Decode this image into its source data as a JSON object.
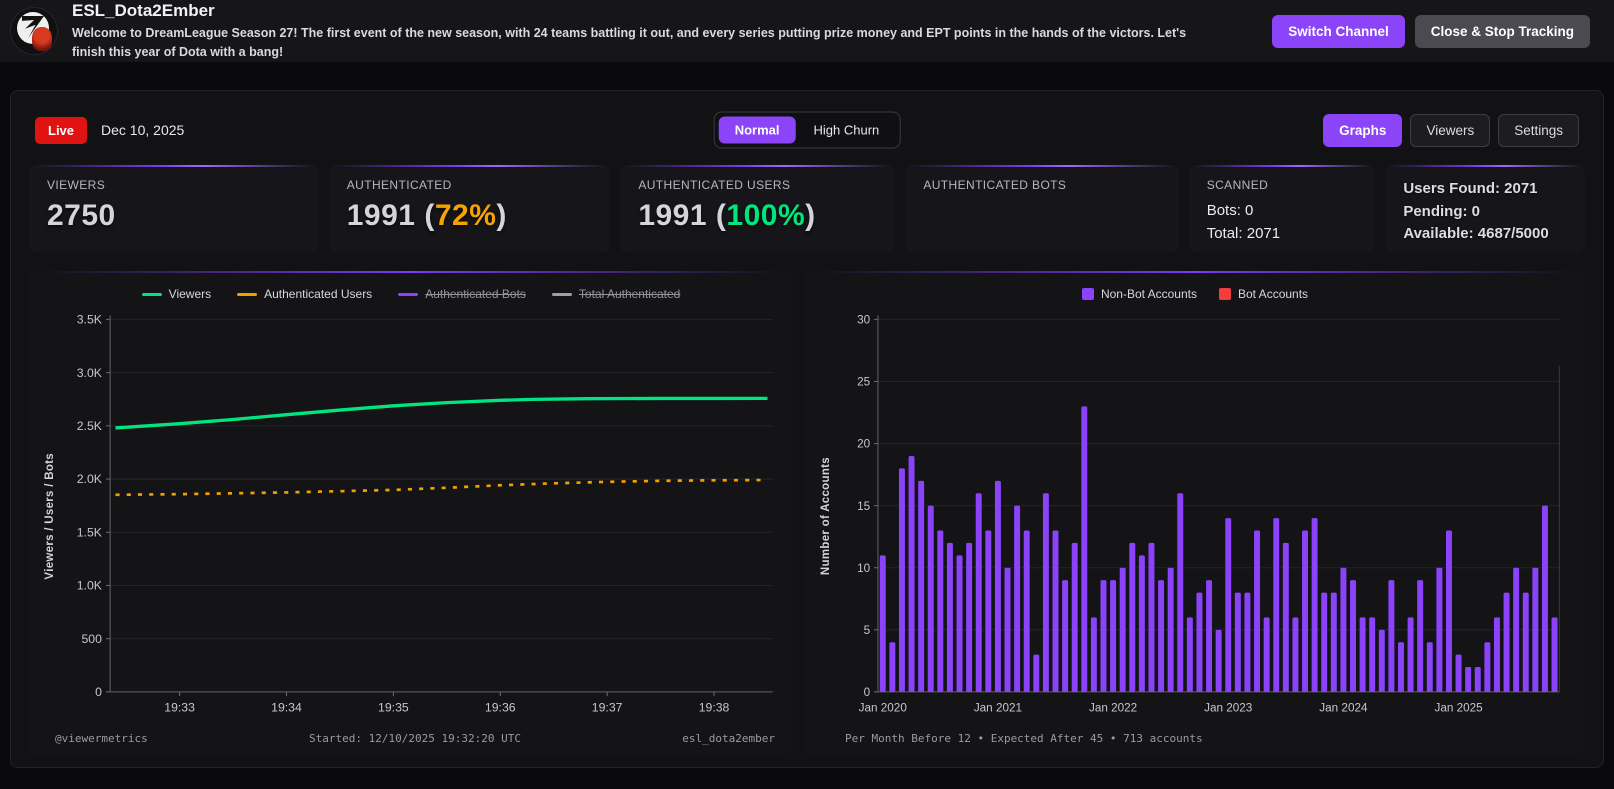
{
  "header": {
    "title": "ESL_Dota2Ember",
    "description": "Welcome to DreamLeague Season 27! The first event of the new season, with 24 teams battling it out, and every series putting prize money and EPT points in the hands of the victors. Let's finish this year of Dota with a bang!",
    "switch_channel_label": "Switch Channel",
    "close_label": "Close & Stop Tracking"
  },
  "toolbar": {
    "live_label": "Live",
    "date": "Dec 10, 2025",
    "mode_toggle": [
      {
        "label": "Normal",
        "active": true
      },
      {
        "label": "High Churn",
        "active": false
      }
    ],
    "view_buttons": [
      {
        "label": "Graphs",
        "active": true
      },
      {
        "label": "Viewers",
        "active": false
      },
      {
        "label": "Settings",
        "active": false
      }
    ]
  },
  "punct": {
    "open": "(",
    "close": ")"
  },
  "stats": {
    "viewers": {
      "label": "VIEWERS",
      "value": "2750"
    },
    "authenticated": {
      "label": "AUTHENTICATED",
      "value": "1991",
      "percent": "72%"
    },
    "authenticated_users": {
      "label": "AUTHENTICATED USERS",
      "value": "1991",
      "percent": "100%"
    },
    "authenticated_bots": {
      "label": "AUTHENTICATED BOTS",
      "value": ""
    },
    "scanned": {
      "label": "SCANNED",
      "bots": "Bots: 0",
      "total": "Total: 2071"
    },
    "quota": {
      "users_found": "Users Found: 2071",
      "pending": "Pending: 0",
      "available": "Available: 4687/5000"
    }
  },
  "colors": {
    "accent_purple": "#8b44f7",
    "live_red": "#e01212",
    "green": "#00e57e",
    "orange": "#f5a300",
    "bar_purple": "#8a43f8",
    "bot_red": "#f23d3d"
  },
  "chart_data": [
    {
      "type": "line",
      "ylabel": "Viewers / Users / Bots",
      "xlim": [
        32.35,
        38.55
      ],
      "ylim": [
        0,
        3500
      ],
      "y_ticks": [
        0,
        500,
        1000,
        1500,
        2000,
        2500,
        3000,
        3500
      ],
      "y_tick_labels": [
        "0",
        "500",
        "1.0K",
        "1.5K",
        "2.0K",
        "2.5K",
        "3.0K",
        "3.5K"
      ],
      "x_ticks": [
        33,
        34,
        35,
        36,
        37,
        38
      ],
      "x_tick_labels": [
        "19:33",
        "19:34",
        "19:35",
        "19:36",
        "19:37",
        "19:38"
      ],
      "grid": true,
      "legend_position": "top-center",
      "series": [
        {
          "name": "Viewers",
          "color": "#00e57e",
          "style": "solid",
          "hidden": false,
          "x": [
            32.4,
            33,
            33.5,
            34,
            34.5,
            35,
            35.5,
            36,
            36.3,
            36.8,
            37.5,
            38,
            38.5
          ],
          "y": [
            2480,
            2520,
            2560,
            2605,
            2648,
            2688,
            2718,
            2740,
            2748,
            2755,
            2757,
            2757,
            2758
          ]
        },
        {
          "name": "Authenticated Users",
          "color": "#f2a000",
          "style": "dashed",
          "hidden": false,
          "x": [
            32.4,
            33,
            34,
            35,
            35.5,
            36,
            36.5,
            37,
            37.5,
            38,
            38.5
          ],
          "y": [
            1852,
            1858,
            1874,
            1898,
            1918,
            1942,
            1960,
            1974,
            1983,
            1988,
            1991
          ]
        },
        {
          "name": "Authenticated Bots",
          "color": "#8a43f8",
          "style": "solid",
          "hidden": true,
          "x": [],
          "y": []
        },
        {
          "name": "Total Authenticated",
          "color": "#9e9ea4",
          "style": "solid",
          "hidden": true,
          "x": [],
          "y": []
        }
      ],
      "footer": {
        "left": "@viewermetrics",
        "center": "Started: 12/10/2025 19:32:20 UTC",
        "right": "esl_dota2ember"
      }
    },
    {
      "type": "bar",
      "ylabel": "Number of Accounts",
      "ylim": [
        0,
        30
      ],
      "y_ticks": [
        0,
        5,
        10,
        15,
        20,
        25,
        30
      ],
      "y_tick_labels": [
        "0",
        "5",
        "10",
        "15",
        "20",
        "25",
        "30"
      ],
      "x_tick_indices": [
        0,
        12,
        24,
        36,
        48,
        60
      ],
      "x_tick_labels": [
        "Jan 2020",
        "Jan 2021",
        "Jan 2022",
        "Jan 2023",
        "Jan 2024",
        "Jan 2025"
      ],
      "grid": true,
      "legend_position": "top-center",
      "series": [
        {
          "name": "Non-Bot Accounts",
          "color": "#8a43f8",
          "values": [
            11,
            4,
            18,
            19,
            17,
            15,
            13,
            12,
            11,
            12,
            16,
            13,
            17,
            10,
            15,
            13,
            3,
            16,
            13,
            9,
            12,
            23,
            6,
            9,
            9,
            10,
            12,
            11,
            12,
            9,
            10,
            16,
            6,
            8,
            9,
            5,
            14,
            8,
            8,
            13,
            6,
            14,
            12,
            6,
            13,
            14,
            8,
            8,
            10,
            9,
            6,
            6,
            5,
            9,
            4,
            6,
            9,
            4,
            10,
            13,
            3,
            2,
            2,
            4,
            6,
            8,
            10,
            8,
            10,
            15,
            6
          ]
        },
        {
          "name": "Bot Accounts",
          "color": "#f23d3d",
          "values": [
            0,
            0,
            0,
            0,
            0,
            0,
            0,
            0,
            0,
            0,
            0,
            0,
            0,
            0,
            0,
            0,
            0,
            0,
            0,
            0,
            0,
            0,
            0,
            0,
            0,
            0,
            0,
            0,
            0,
            0,
            0,
            0,
            0,
            0,
            0,
            0,
            0,
            0,
            0,
            0,
            0,
            0,
            0,
            0,
            0,
            0,
            0,
            0,
            0,
            0,
            0,
            0,
            0,
            0,
            0,
            0,
            0,
            0,
            0,
            0,
            0,
            0,
            0,
            0,
            0,
            0,
            0,
            0,
            0,
            0,
            0
          ]
        }
      ],
      "footer": "Per Month Before 12 • Expected After 45 • 713 accounts"
    }
  ]
}
